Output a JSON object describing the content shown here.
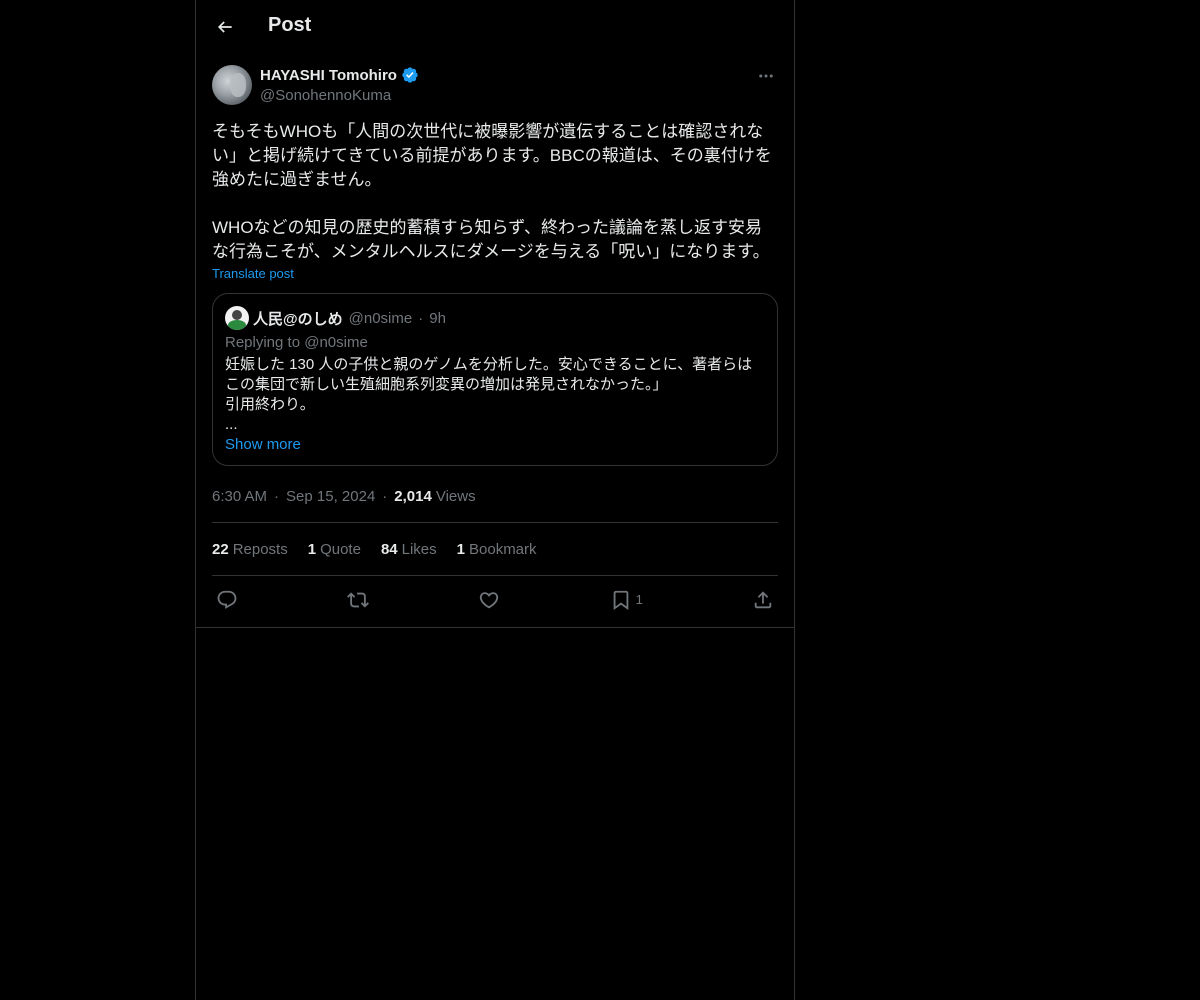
{
  "header": {
    "title": "Post"
  },
  "post": {
    "author_name": "HAYASHI Tomohiro",
    "author_handle": "@SonohennoKuma",
    "text": "そもそもWHOも「人間の次世代に被曝影響が遺伝することは確認されない」と掲げ続けてきている前提があります。BBCの報道は、その裏付けを強めたに過ぎません。\n\nWHOなどの知見の歴史的蓄積すら知らず、終わった議論を蒸し返す安易な行為こそが、メンタルヘルスにダメージを与える「呪い」になります。",
    "translate_label": "Translate post",
    "time": "6:30 AM",
    "date": "Sep 15, 2024",
    "views_count": "2,014",
    "views_label": "Views"
  },
  "quote": {
    "author_name": "人民@のしめ",
    "author_handle": "@n0sime",
    "time": "9h",
    "replying_to": "Replying to @n0sime",
    "text": "妊娠した 130 人の子供と親のゲノムを分析した。安心できることに、著者らはこの集団で新しい生殖細胞系列変異の増加は発見されなかった。」\n引用終わり。\n...",
    "show_more": "Show more"
  },
  "stats": {
    "reposts_count": "22",
    "reposts_label": "Reposts",
    "quotes_count": "1",
    "quotes_label": "Quote",
    "likes_count": "84",
    "likes_label": "Likes",
    "bookmarks_count": "1",
    "bookmarks_label": "Bookmark"
  },
  "actions": {
    "bookmark_count": "1"
  },
  "icons": {
    "back": "arrow-left-icon",
    "verified": "verified-badge-icon",
    "more": "more-horizontal-icon",
    "reply": "reply-icon",
    "repost": "repost-icon",
    "like": "heart-icon",
    "bookmark": "bookmark-icon",
    "share": "share-icon"
  },
  "colors": {
    "background": "#000000",
    "text": "#e7e9ea",
    "secondary_text": "#71767b",
    "accent": "#1d9bf0",
    "border": "#2f3336"
  }
}
